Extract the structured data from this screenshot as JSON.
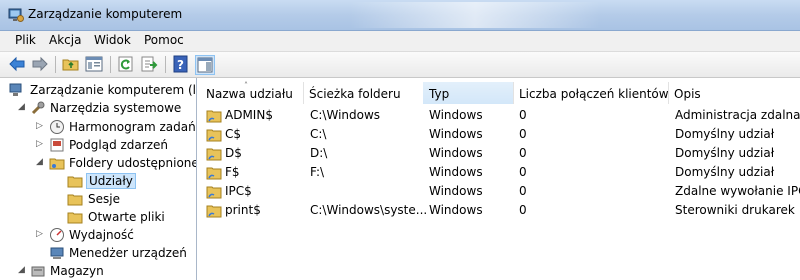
{
  "window": {
    "title": "Zarządzanie komputerem",
    "icon": "computer-management-icon"
  },
  "menu": [
    "Plik",
    "Akcja",
    "Widok",
    "Pomoc"
  ],
  "toolbar": {
    "buttons": [
      "back-arrow-icon",
      "forward-arrow-icon",
      "up-folder-icon",
      "show-hide-tree-icon",
      "refresh-icon",
      "export-list-icon",
      "help-icon",
      "show-hide-action-pane-icon"
    ]
  },
  "tree": {
    "root": "Zarządzanie komputerem (loka",
    "items": [
      {
        "label": "Narzędzia systemowe",
        "icon": "tools-icon"
      },
      {
        "label": "Harmonogram zadań",
        "icon": "clock-icon"
      },
      {
        "label": "Podgląd zdarzeń",
        "icon": "event-viewer-icon"
      },
      {
        "label": "Foldery udostępnione",
        "icon": "shared-folder-icon"
      },
      {
        "label": "Udziały",
        "icon": "folder-icon",
        "selected": true
      },
      {
        "label": "Sesje",
        "icon": "folder-icon"
      },
      {
        "label": "Otwarte pliki",
        "icon": "folder-icon"
      },
      {
        "label": "Wydajność",
        "icon": "performance-icon"
      },
      {
        "label": "Menedżer urządzeń",
        "icon": "device-manager-icon"
      },
      {
        "label": "Magazyn",
        "icon": "storage-icon"
      }
    ]
  },
  "table": {
    "columns": [
      "Nazwa udziału",
      "Ścieżka folderu",
      "Typ",
      "Liczba połączeń klientów",
      "Opis"
    ],
    "sorted_column": "Typ",
    "rows": [
      {
        "name": "ADMIN$",
        "path": "C:\\Windows",
        "type": "Windows",
        "connections": "0",
        "desc": "Administracja zdalna"
      },
      {
        "name": "C$",
        "path": "C:\\",
        "type": "Windows",
        "connections": "0",
        "desc": "Domyślny udział"
      },
      {
        "name": "D$",
        "path": "D:\\",
        "type": "Windows",
        "connections": "0",
        "desc": "Domyślny udział"
      },
      {
        "name": "F$",
        "path": "F:\\",
        "type": "Windows",
        "connections": "0",
        "desc": "Domyślny udział"
      },
      {
        "name": "IPC$",
        "path": "",
        "type": "Windows",
        "connections": "0",
        "desc": "Zdalne wywołanie IPC"
      },
      {
        "name": "print$",
        "path": "C:\\Windows\\syste...",
        "type": "Windows",
        "connections": "0",
        "desc": "Sterowniki drukarek"
      }
    ]
  },
  "colors": {
    "selection": "#cde5fb",
    "selection_border": "#8ec3f2",
    "titlebar": "#b4cbe8"
  }
}
